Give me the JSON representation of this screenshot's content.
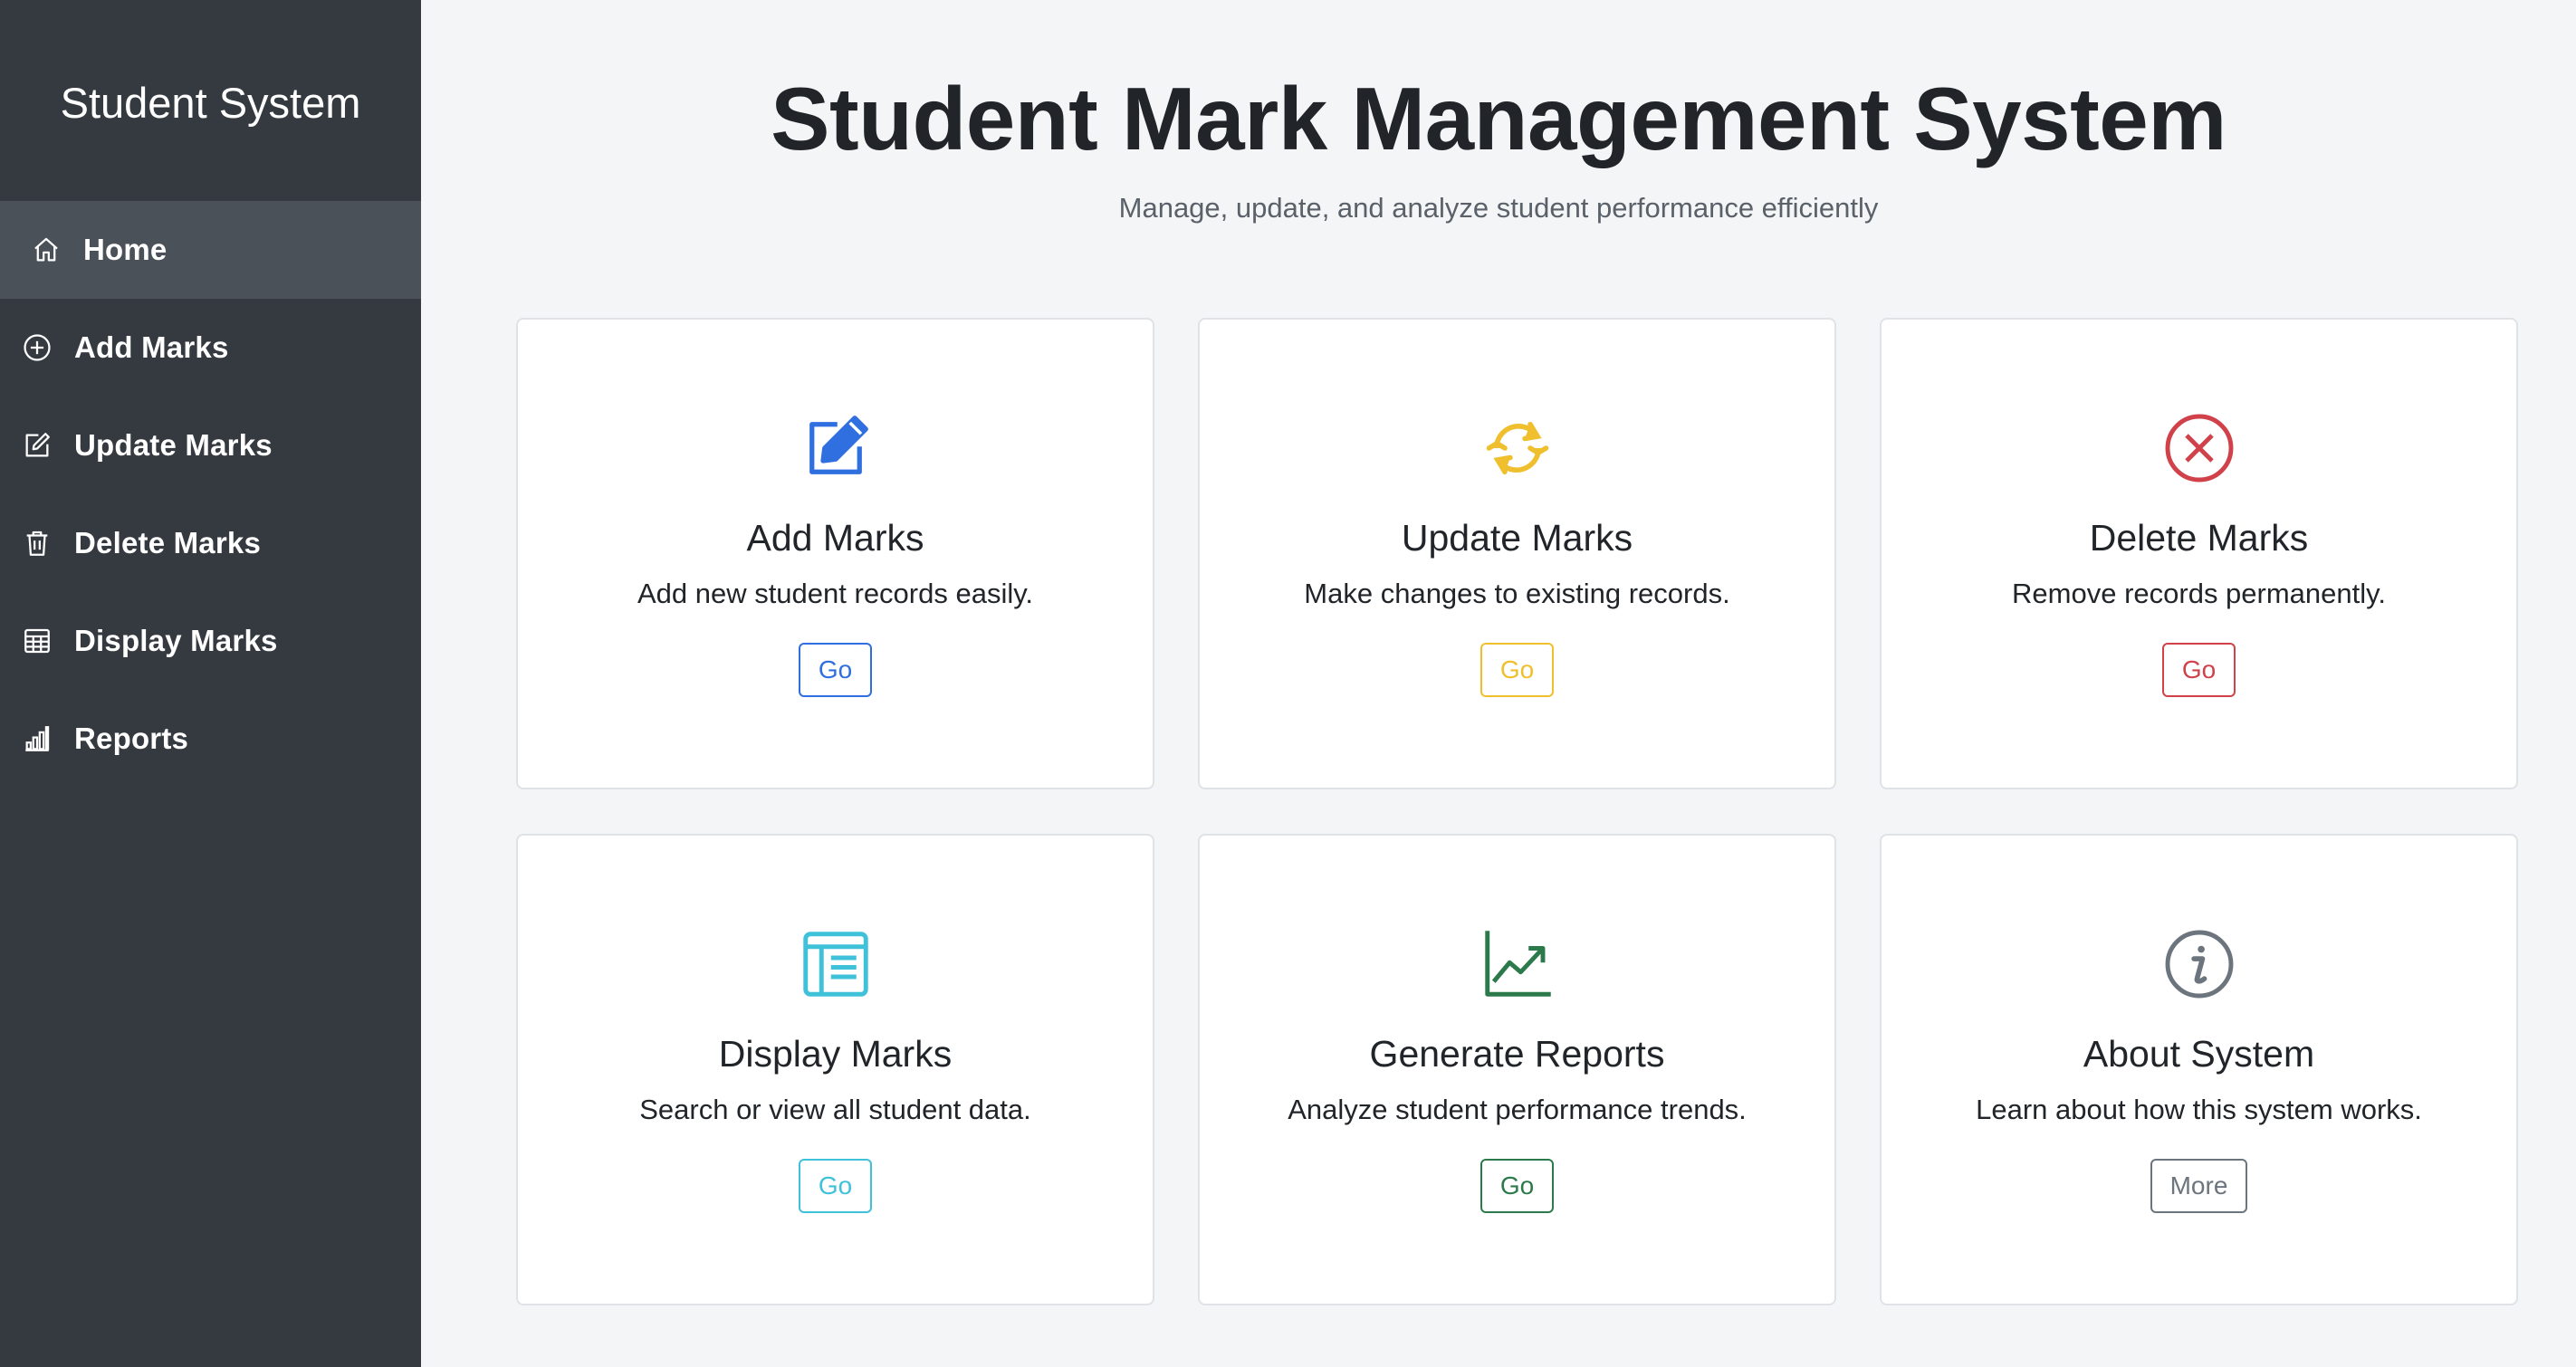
{
  "sidebar": {
    "brand": "Student System",
    "items": [
      {
        "label": "Home",
        "icon": "home-icon",
        "active": true
      },
      {
        "label": "Add Marks",
        "icon": "plus-circle-icon",
        "active": false
      },
      {
        "label": "Update Marks",
        "icon": "edit-icon",
        "active": false
      },
      {
        "label": "Delete Marks",
        "icon": "trash-icon",
        "active": false
      },
      {
        "label": "Display Marks",
        "icon": "table-icon",
        "active": false
      },
      {
        "label": "Reports",
        "icon": "bar-chart-icon",
        "active": false
      }
    ]
  },
  "header": {
    "title": "Student Mark Management System",
    "subtitle": "Manage, update, and analyze student performance efficiently"
  },
  "cards": [
    {
      "title": "Add Marks",
      "text": "Add new student records easily.",
      "button": "Go",
      "icon": "pencil-square-icon",
      "color": "#2f6fe0"
    },
    {
      "title": "Update Marks",
      "text": "Make changes to existing records.",
      "button": "Go",
      "icon": "refresh-icon",
      "color": "#f0bf2e"
    },
    {
      "title": "Delete Marks",
      "text": "Remove records permanently.",
      "button": "Go",
      "icon": "x-circle-icon",
      "color": "#d0414a"
    },
    {
      "title": "Display Marks",
      "text": "Search or view all student data.",
      "button": "Go",
      "icon": "list-layout-icon",
      "color": "#3fc1da"
    },
    {
      "title": "Generate Reports",
      "text": "Analyze student performance trends.",
      "button": "Go",
      "icon": "trend-chart-icon",
      "color": "#2c7a4b"
    },
    {
      "title": "About System",
      "text": "Learn about how this system works.",
      "button": "More",
      "icon": "info-circle-icon",
      "color": "#6c757d"
    }
  ],
  "colors": {
    "sidebar_bg": "#343a40",
    "sidebar_active": "#4b5159",
    "page_bg": "#f4f5f7"
  }
}
